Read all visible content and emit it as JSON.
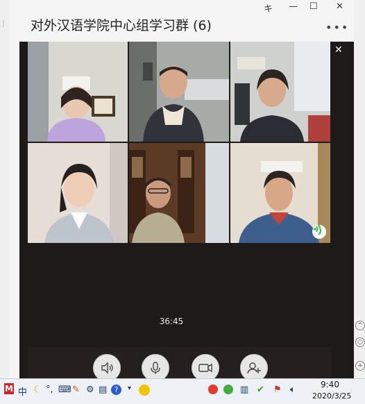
{
  "window": {
    "title": "对外汉语学院中心组学习群 (6)",
    "pin_glyph": "キ",
    "minimize_glyph": "—",
    "maximize_glyph": "☐",
    "close_glyph": "✕",
    "more_glyph": "•••"
  },
  "video_call": {
    "pin_glyph": "キ",
    "close_glyph": "✕",
    "elapsed": "36:45",
    "participants": [
      {
        "name": "participant-1",
        "icon": "video-feed"
      },
      {
        "name": "participant-2",
        "icon": "video-feed"
      },
      {
        "name": "participant-3",
        "icon": "video-feed"
      },
      {
        "name": "participant-4",
        "icon": "video-feed"
      },
      {
        "name": "participant-5",
        "icon": "video-feed"
      },
      {
        "name": "participant-6",
        "icon": "speaking-indicator-icon"
      }
    ],
    "controls": [
      {
        "name": "speaker-button",
        "icon": "speaker-icon"
      },
      {
        "name": "microphone-button",
        "icon": "microphone-icon"
      },
      {
        "name": "camera-button",
        "icon": "camera-icon"
      },
      {
        "name": "add-member-button",
        "icon": "add-person-icon"
      }
    ]
  },
  "taskbar": {
    "ime_lang": "中",
    "clock_time": "9:40",
    "clock_date": "2020/3/25"
  },
  "colors": {
    "panel_bg": "#1f1a1a",
    "speaking_green": "#2fbf4a",
    "taskbar_bg": "#eef2f6"
  }
}
